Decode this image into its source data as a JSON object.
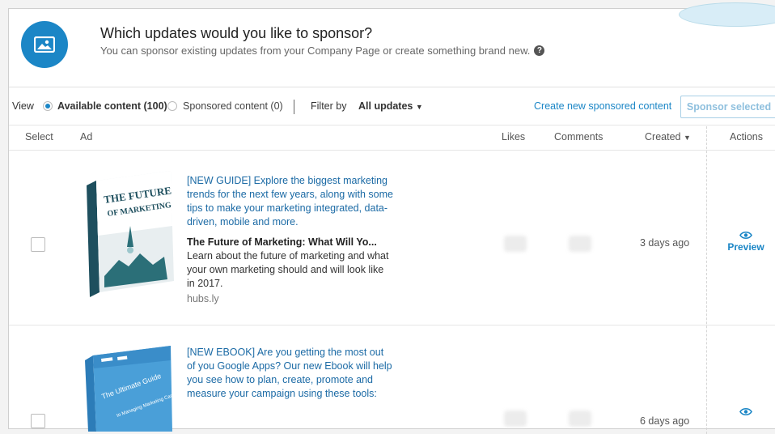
{
  "header": {
    "title": "Which updates would you like to sponsor?",
    "subtitle": "You can sponsor existing updates from your Company Page or create something brand new.",
    "icon": "image-icon",
    "help_icon_glyph": "?"
  },
  "filters": {
    "view_label": "View",
    "available_label": "Available content (100)",
    "sponsored_label": "Sponsored content (0)",
    "available_selected": true,
    "filter_label": "Filter by",
    "filter_value": "All updates",
    "create_link": "Create new sponsored content",
    "sponsor_selected_button": "Sponsor selected"
  },
  "columns": {
    "select": "Select",
    "ad": "Ad",
    "likes": "Likes",
    "comments": "Comments",
    "created": "Created",
    "actions": "Actions"
  },
  "rows": [
    {
      "headline": "[NEW GUIDE] Explore the biggest marketing trends for the next few years, along with some tips to make your marketing integrated, data-driven, mobile and more.",
      "title": "The Future of Marketing: What Will Yo...",
      "description": "Learn about the future of marketing and what your own marketing should and will look like in 2017.",
      "domain": "hubs.ly",
      "created": "3 days ago",
      "action": "Preview",
      "cover_title_1": "THE FUTURE",
      "cover_title_2": "OF MARKETING"
    },
    {
      "headline": "[NEW EBOOK] Are you getting the most out of you Google Apps? Our new Ebook will help you see how to plan, create, promote and measure your campaign using these tools:",
      "created": "6 days ago",
      "cover_title_1": "The Ultimate Guide",
      "cover_title_2": "to Managing Marketing Campaigns"
    }
  ],
  "colors": {
    "accent": "#1b86c6",
    "link": "#1b6aa5"
  }
}
